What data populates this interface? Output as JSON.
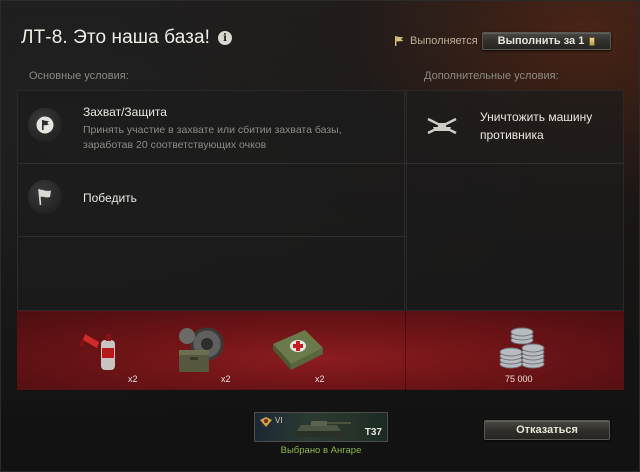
{
  "window": {
    "title": "ЛТ-8. Это наша база!",
    "status_text": "Выполняется",
    "complete_button": "Выполнить за 1",
    "decline_button": "Отказаться"
  },
  "main_conditions": {
    "label": "Основные условия:",
    "items": [
      {
        "title": "Захват/Защита",
        "description": "Принять участие в захвате или сбитии захвата базы, заработав 20 соответствующих очков",
        "icon": "flag-icon"
      },
      {
        "title": "Победить",
        "description": "",
        "icon": "white-flag-icon"
      }
    ]
  },
  "additional_conditions": {
    "label": "Дополнительные условия:",
    "items": [
      {
        "title": "Уничтожить машину противника",
        "icon": "destroyed-tank-icon"
      }
    ]
  },
  "rewards": [
    {
      "name": "fire-extinguisher-reward",
      "count": "x2"
    },
    {
      "name": "repair-kit-reward",
      "count": "x2"
    },
    {
      "name": "first-aid-kit-reward",
      "count": "x2"
    },
    {
      "name": "credits-reward",
      "count": "75 000"
    }
  ],
  "tank": {
    "tier": "VI",
    "name": "T37",
    "hangar_note": "Выбрано в Ангаре"
  },
  "colors": {
    "reward_band": "#7a1a1c",
    "hangar_note": "#8fb548",
    "accent_gold": "#d9c07a"
  }
}
